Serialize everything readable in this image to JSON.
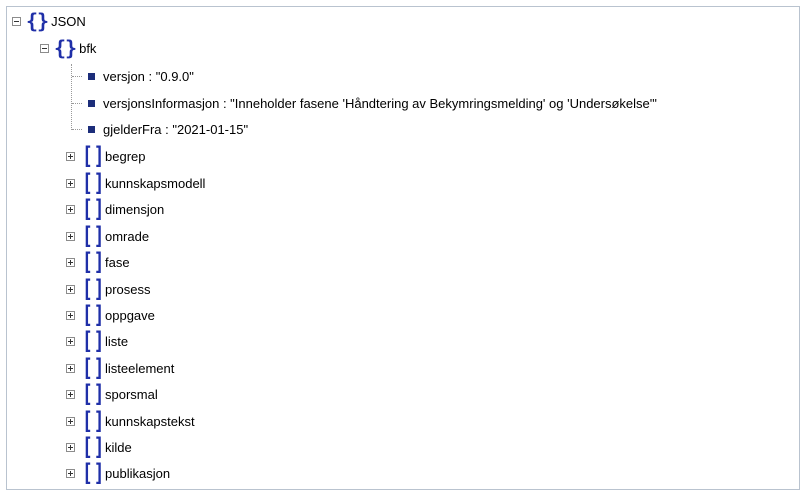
{
  "tree": {
    "root_label": "JSON",
    "child_label": "bfk",
    "properties": [
      {
        "key": "versjon",
        "value": "\"0.9.0\"",
        "text": "versjon : \"0.9.0\""
      },
      {
        "key": "versjonsInformasjon",
        "value": "\"Inneholder fasene 'Håndtering av Bekymringsmelding' og 'Undersøkelse'\"",
        "text": "versjonsInformasjon : \"Inneholder fasene 'Håndtering av Bekymringsmelding' og 'Undersøkelse'\""
      },
      {
        "key": "gjelderFra",
        "value": "\"2021-01-15\"",
        "text": "gjelderFra : \"2021-01-15\""
      }
    ],
    "arrays": [
      "begrep",
      "kunnskapsmodell",
      "dimensjon",
      "omrade",
      "fase",
      "prosess",
      "oppgave",
      "liste",
      "listeelement",
      "sporsmal",
      "kunnskapstekst",
      "kilde",
      "publikasjon"
    ]
  },
  "icons": {
    "object": "curly-braces-icon",
    "array": "square-brackets-icon",
    "property": "square-bullet-icon",
    "expanded": "minus-toggle-icon",
    "collapsed": "plus-toggle-icon"
  },
  "colors": {
    "brace": "#1f2fa8",
    "bullet": "#1c2d7a",
    "frame_border": "#b9c3cf"
  }
}
